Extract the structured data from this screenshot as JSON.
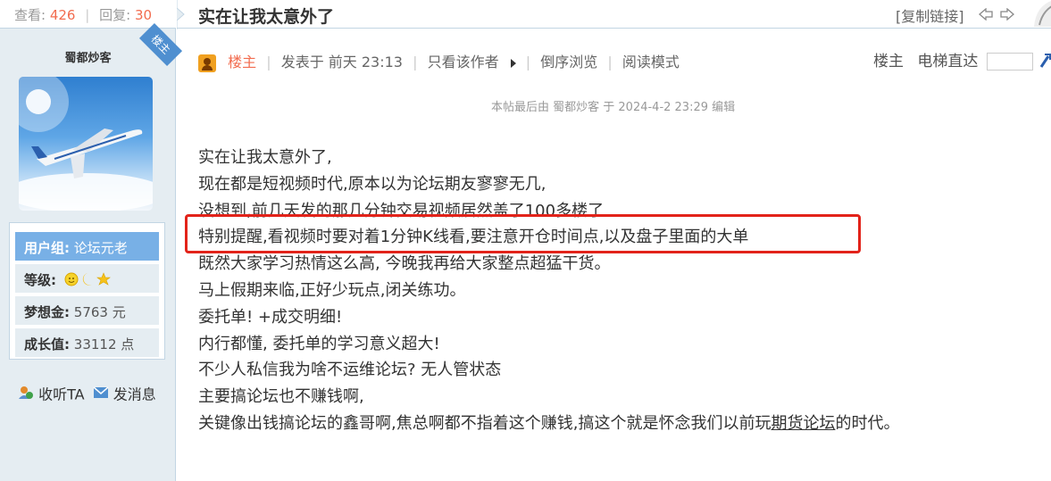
{
  "stats": {
    "views_label": "查看:",
    "views": "426",
    "replies_label": "回复:",
    "replies": "30"
  },
  "author": {
    "name": "蜀都炒客",
    "badge": "楼主",
    "group_label": "用户组:",
    "group_value": "论坛元老",
    "level_label": "等级:",
    "points_label": "梦想金:",
    "points_value": "5763 元",
    "growth_label": "成长值:",
    "growth_value": "33112 点",
    "follow_label": "收听TA",
    "message_label": "发消息"
  },
  "thread": {
    "title": "实在让我太意外了",
    "copy_link": "[复制链接]"
  },
  "post_header": {
    "owner": "楼主",
    "posted": "发表于 前天 23:13",
    "only_author": "只看该作者",
    "reverse": "倒序浏览",
    "read_mode": "阅读模式",
    "floor": "楼主",
    "jump_label": "电梯直达"
  },
  "edit_note": "本帖最后由 蜀都炒客 于 2024-4-2 23:29 编辑",
  "content": {
    "lines": [
      "实在让我太意外了,",
      "现在都是短视频时代,原本以为论坛期友寥寥无几,",
      "没想到,前几天发的那几分钟交易视频居然盖了100多楼了",
      "特别提醒,看视频时要对着1分钟K线看,要注意开仓时间点,以及盘子里面的大单",
      "既然大家学习热情这么高, 今晚我再给大家整点超猛干货。",
      "马上假期来临,正好少玩点,闭关练功。",
      "委托单! +成交明细!",
      "内行都懂, 委托单的学习意义超大!",
      "不少人私信我为啥不运维论坛? 无人管状态",
      "主要搞论坛也不赚钱啊,"
    ],
    "last_line_prefix": "关键像出钱搞论坛的鑫哥啊,焦总啊都不指着这个赚钱,搞这个就是怀念我们以前玩",
    "last_line_link": "期货论坛",
    "last_line_suffix": "的时代。"
  },
  "colors": {
    "accent": "#f26c4f",
    "sidebar_bg": "#e5edf2",
    "group_bg": "#78b0e6",
    "highlight": "#e2231a"
  }
}
